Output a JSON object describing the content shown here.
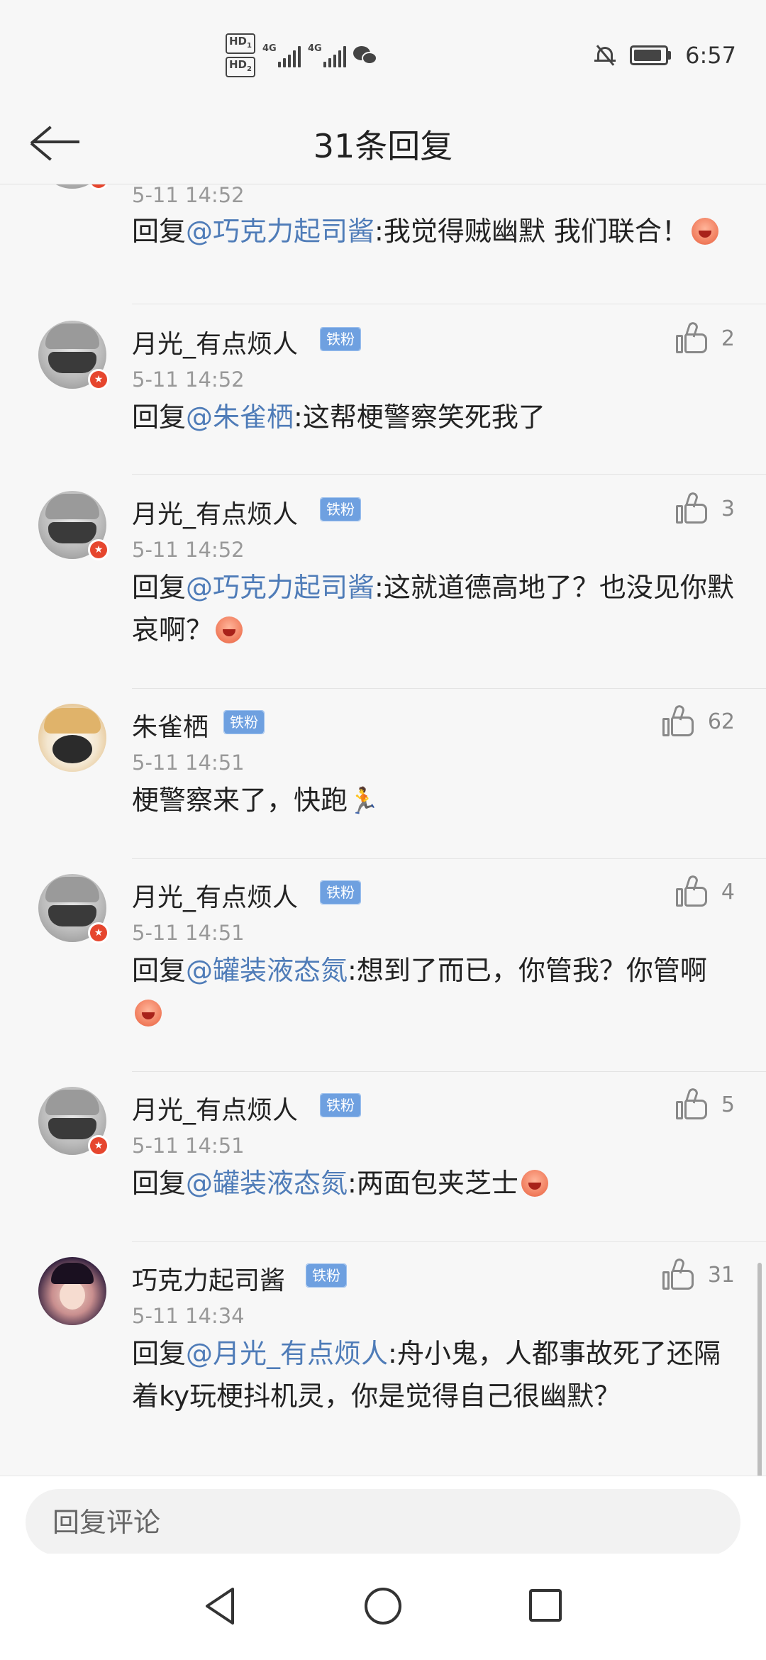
{
  "status_bar": {
    "hd1": "HD",
    "hd1_sub": "1",
    "hd2": "HD",
    "hd2_sub": "2",
    "net1": "4G",
    "net2": "4G",
    "time": "6:57",
    "battery_level": 0.9
  },
  "header": {
    "title": "31条回复"
  },
  "comments": [
    {
      "name": "",
      "badge": "",
      "time": "5-11 14:52",
      "prefix": "回复",
      "mention": "@巧克力起司酱",
      "text": ":我觉得贼幽默  我们联合！",
      "likes": ""
    },
    {
      "name": "月光_有点烦人",
      "badge": "铁粉",
      "time": "5-11 14:52",
      "prefix": "回复",
      "mention": "@朱雀栖",
      "text": ":这帮梗警察笑死我了",
      "likes": "2"
    },
    {
      "name": "月光_有点烦人",
      "badge": "铁粉",
      "time": "5-11 14:52",
      "prefix": "回复",
      "mention": "@巧克力起司酱",
      "text": ":这就道德高地了？也没见你默哀啊？",
      "likes": "3"
    },
    {
      "name": "朱雀栖",
      "badge": "铁粉",
      "time": "5-11 14:51",
      "prefix": "",
      "mention": "",
      "text": "梗警察来了，快跑",
      "likes": "62"
    },
    {
      "name": "月光_有点烦人",
      "badge": "铁粉",
      "time": "5-11 14:51",
      "prefix": "回复",
      "mention": "@罐装液态氮",
      "text": ":想到了而已，你管我？你管啊",
      "likes": "4"
    },
    {
      "name": "月光_有点烦人",
      "badge": "铁粉",
      "time": "5-11 14:51",
      "prefix": "回复",
      "mention": "@罐装液态氮",
      "text": ":两面包夹芝士",
      "likes": "5"
    },
    {
      "name": "巧克力起司酱",
      "badge": "铁粉",
      "time": "5-11 14:34",
      "prefix": "回复",
      "mention": "@月光_有点烦人",
      "text": ":舟小鬼，人都事故死了还隔着ky玩梗抖机灵，你是觉得自己很幽默？",
      "likes": "31"
    }
  ],
  "input": {
    "placeholder": "回复评论"
  },
  "icons": {
    "back": "arrow-left-icon",
    "like": "thumbs-up-icon",
    "nav_back": "triangle-back-icon",
    "nav_home": "circle-home-icon",
    "nav_recent": "square-recent-icon"
  },
  "colors": {
    "mention": "#4f7cb8",
    "badge": "#6ea0e0",
    "vip": "#e6462e"
  }
}
